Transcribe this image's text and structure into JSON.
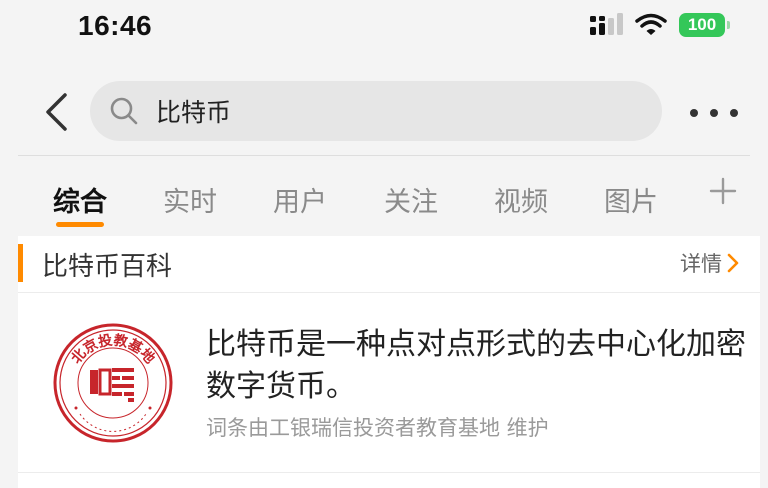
{
  "status": {
    "time": "16:46",
    "battery": "100",
    "icons": [
      "signal-icon",
      "wifi-icon",
      "battery-icon"
    ]
  },
  "nav": {
    "back_icon": "chevron-left-icon",
    "search_icon": "search-icon",
    "search_value": "比特币",
    "more_icon": "more-dots-icon"
  },
  "tabs": {
    "items": [
      "综合",
      "实时",
      "用户",
      "关注",
      "视频",
      "图片"
    ],
    "active_index": 0,
    "add_icon": "plus-icon"
  },
  "card": {
    "title": "比特币百科",
    "detail_label": "详情",
    "detail_icon": "chevron-right-icon",
    "description": "比特币是一种点对点形式的去中心化加密数字货币。",
    "source": "词条由工银瑞信投资者教育基地 维护",
    "logo_text": "北京投教基地"
  },
  "colors": {
    "accent": "#ff8a00",
    "battery": "#34c759",
    "seal_red": "#c7252b"
  }
}
